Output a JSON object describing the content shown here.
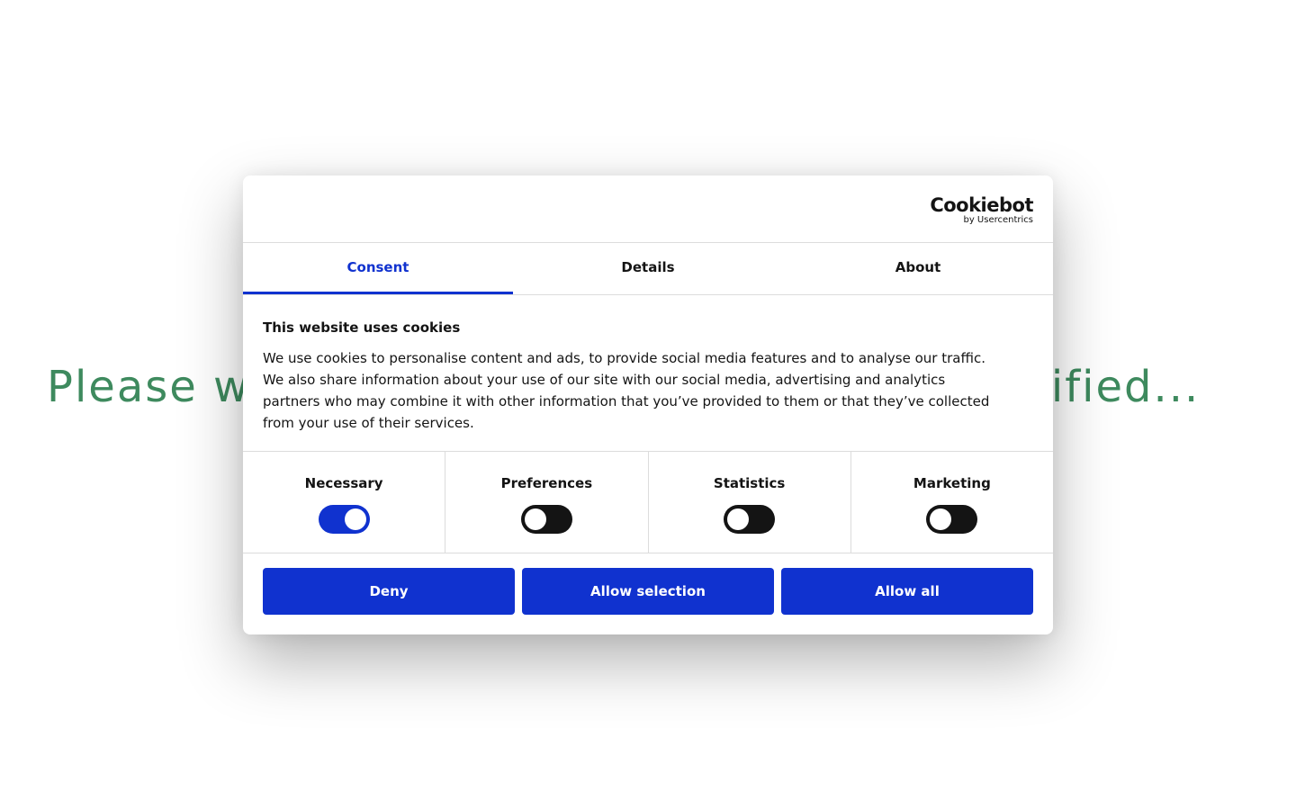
{
  "background": {
    "message": "Please wait while your request is being verified..."
  },
  "dialog": {
    "brand": {
      "name": "Cookiebot",
      "sub": "by Usercentrics"
    },
    "tabs": [
      {
        "label": "Consent",
        "active": true
      },
      {
        "label": "Details",
        "active": false
      },
      {
        "label": "About",
        "active": false
      }
    ],
    "title": "This website uses cookies",
    "description": "We use cookies to personalise content and ads, to provide social media features and to analyse our traffic. We also share information about your use of our site with our social media, advertising and analytics partners who may combine it with other information that you’ve provided to them or that they’ve collected from your use of their services.",
    "toggles": [
      {
        "label": "Necessary",
        "checked": true
      },
      {
        "label": "Preferences",
        "checked": false
      },
      {
        "label": "Statistics",
        "checked": false
      },
      {
        "label": "Marketing",
        "checked": false
      }
    ],
    "buttons": {
      "deny": "Deny",
      "allow_selection": "Allow selection",
      "allow_all": "Allow all"
    }
  },
  "colors": {
    "accent": "#1032cf",
    "message": "#3e8a5e",
    "toggle_off": "#141414"
  }
}
